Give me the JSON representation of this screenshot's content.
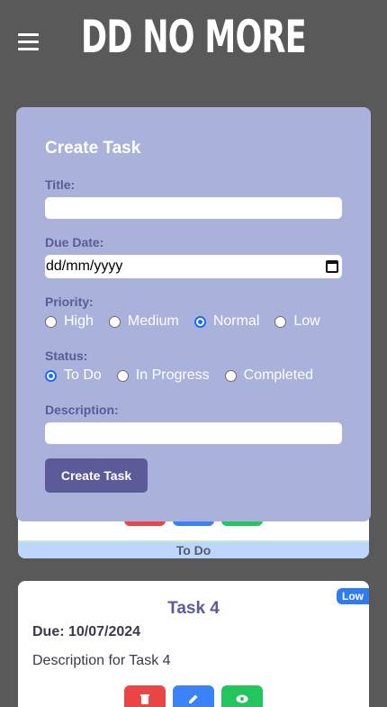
{
  "app": {
    "title": "DD NO MORE"
  },
  "form": {
    "title": "Create Task",
    "title_label": "Title:",
    "title_value": "",
    "due_label": "Due Date:",
    "due_placeholder": "dd/mm/yyyy",
    "priority_label": "Priority:",
    "priority_options": [
      "High",
      "Medium",
      "Normal",
      "Low"
    ],
    "priority_selected": "Normal",
    "status_label": "Status:",
    "status_options": [
      "To Do",
      "In Progress",
      "Completed"
    ],
    "status_selected": "To Do",
    "description_label": "Description:",
    "description_value": "",
    "submit_label": "Create Task"
  },
  "bg_card": {
    "status": "To Do"
  },
  "task": {
    "title": "Task 4",
    "priority_badge": "Low",
    "due": "Due: 10/07/2024",
    "description": "Description for Task 4"
  },
  "colors": {
    "background": "#595959",
    "form_bg": "#aab1da",
    "accent": "#5d5a99",
    "delete": "#ea4646",
    "edit": "#3b82f6",
    "view": "#22c55e"
  }
}
